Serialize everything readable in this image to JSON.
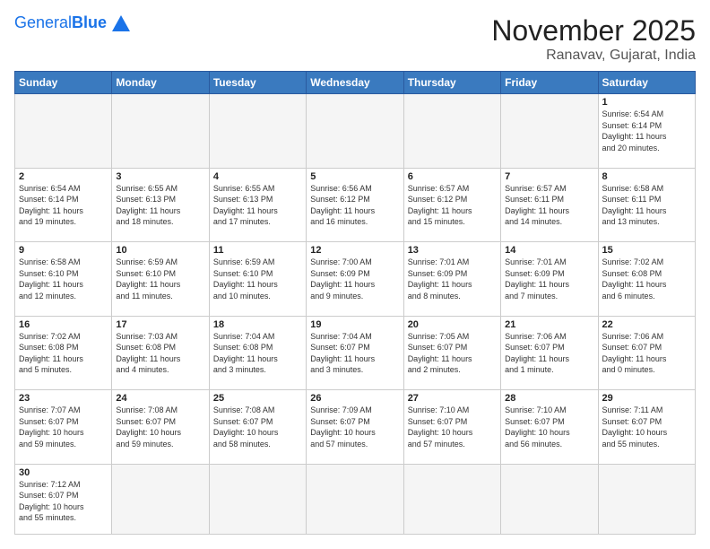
{
  "header": {
    "logo_general": "General",
    "logo_blue": "Blue",
    "month_title": "November 2025",
    "location": "Ranavav, Gujarat, India"
  },
  "weekdays": [
    "Sunday",
    "Monday",
    "Tuesday",
    "Wednesday",
    "Thursday",
    "Friday",
    "Saturday"
  ],
  "weeks": [
    [
      {
        "day": "",
        "text": ""
      },
      {
        "day": "",
        "text": ""
      },
      {
        "day": "",
        "text": ""
      },
      {
        "day": "",
        "text": ""
      },
      {
        "day": "",
        "text": ""
      },
      {
        "day": "",
        "text": ""
      },
      {
        "day": "1",
        "text": "Sunrise: 6:54 AM\nSunset: 6:14 PM\nDaylight: 11 hours\nand 20 minutes."
      }
    ],
    [
      {
        "day": "2",
        "text": "Sunrise: 6:54 AM\nSunset: 6:14 PM\nDaylight: 11 hours\nand 19 minutes."
      },
      {
        "day": "3",
        "text": "Sunrise: 6:55 AM\nSunset: 6:13 PM\nDaylight: 11 hours\nand 18 minutes."
      },
      {
        "day": "4",
        "text": "Sunrise: 6:55 AM\nSunset: 6:13 PM\nDaylight: 11 hours\nand 17 minutes."
      },
      {
        "day": "5",
        "text": "Sunrise: 6:56 AM\nSunset: 6:12 PM\nDaylight: 11 hours\nand 16 minutes."
      },
      {
        "day": "6",
        "text": "Sunrise: 6:57 AM\nSunset: 6:12 PM\nDaylight: 11 hours\nand 15 minutes."
      },
      {
        "day": "7",
        "text": "Sunrise: 6:57 AM\nSunset: 6:11 PM\nDaylight: 11 hours\nand 14 minutes."
      },
      {
        "day": "8",
        "text": "Sunrise: 6:58 AM\nSunset: 6:11 PM\nDaylight: 11 hours\nand 13 minutes."
      }
    ],
    [
      {
        "day": "9",
        "text": "Sunrise: 6:58 AM\nSunset: 6:10 PM\nDaylight: 11 hours\nand 12 minutes."
      },
      {
        "day": "10",
        "text": "Sunrise: 6:59 AM\nSunset: 6:10 PM\nDaylight: 11 hours\nand 11 minutes."
      },
      {
        "day": "11",
        "text": "Sunrise: 6:59 AM\nSunset: 6:10 PM\nDaylight: 11 hours\nand 10 minutes."
      },
      {
        "day": "12",
        "text": "Sunrise: 7:00 AM\nSunset: 6:09 PM\nDaylight: 11 hours\nand 9 minutes."
      },
      {
        "day": "13",
        "text": "Sunrise: 7:01 AM\nSunset: 6:09 PM\nDaylight: 11 hours\nand 8 minutes."
      },
      {
        "day": "14",
        "text": "Sunrise: 7:01 AM\nSunset: 6:09 PM\nDaylight: 11 hours\nand 7 minutes."
      },
      {
        "day": "15",
        "text": "Sunrise: 7:02 AM\nSunset: 6:08 PM\nDaylight: 11 hours\nand 6 minutes."
      }
    ],
    [
      {
        "day": "16",
        "text": "Sunrise: 7:02 AM\nSunset: 6:08 PM\nDaylight: 11 hours\nand 5 minutes."
      },
      {
        "day": "17",
        "text": "Sunrise: 7:03 AM\nSunset: 6:08 PM\nDaylight: 11 hours\nand 4 minutes."
      },
      {
        "day": "18",
        "text": "Sunrise: 7:04 AM\nSunset: 6:08 PM\nDaylight: 11 hours\nand 3 minutes."
      },
      {
        "day": "19",
        "text": "Sunrise: 7:04 AM\nSunset: 6:07 PM\nDaylight: 11 hours\nand 3 minutes."
      },
      {
        "day": "20",
        "text": "Sunrise: 7:05 AM\nSunset: 6:07 PM\nDaylight: 11 hours\nand 2 minutes."
      },
      {
        "day": "21",
        "text": "Sunrise: 7:06 AM\nSunset: 6:07 PM\nDaylight: 11 hours\nand 1 minute."
      },
      {
        "day": "22",
        "text": "Sunrise: 7:06 AM\nSunset: 6:07 PM\nDaylight: 11 hours\nand 0 minutes."
      }
    ],
    [
      {
        "day": "23",
        "text": "Sunrise: 7:07 AM\nSunset: 6:07 PM\nDaylight: 10 hours\nand 59 minutes."
      },
      {
        "day": "24",
        "text": "Sunrise: 7:08 AM\nSunset: 6:07 PM\nDaylight: 10 hours\nand 59 minutes."
      },
      {
        "day": "25",
        "text": "Sunrise: 7:08 AM\nSunset: 6:07 PM\nDaylight: 10 hours\nand 58 minutes."
      },
      {
        "day": "26",
        "text": "Sunrise: 7:09 AM\nSunset: 6:07 PM\nDaylight: 10 hours\nand 57 minutes."
      },
      {
        "day": "27",
        "text": "Sunrise: 7:10 AM\nSunset: 6:07 PM\nDaylight: 10 hours\nand 57 minutes."
      },
      {
        "day": "28",
        "text": "Sunrise: 7:10 AM\nSunset: 6:07 PM\nDaylight: 10 hours\nand 56 minutes."
      },
      {
        "day": "29",
        "text": "Sunrise: 7:11 AM\nSunset: 6:07 PM\nDaylight: 10 hours\nand 55 minutes."
      }
    ],
    [
      {
        "day": "30",
        "text": "Sunrise: 7:12 AM\nSunset: 6:07 PM\nDaylight: 10 hours\nand 55 minutes."
      },
      {
        "day": "",
        "text": ""
      },
      {
        "day": "",
        "text": ""
      },
      {
        "day": "",
        "text": ""
      },
      {
        "day": "",
        "text": ""
      },
      {
        "day": "",
        "text": ""
      },
      {
        "day": "",
        "text": ""
      }
    ]
  ]
}
